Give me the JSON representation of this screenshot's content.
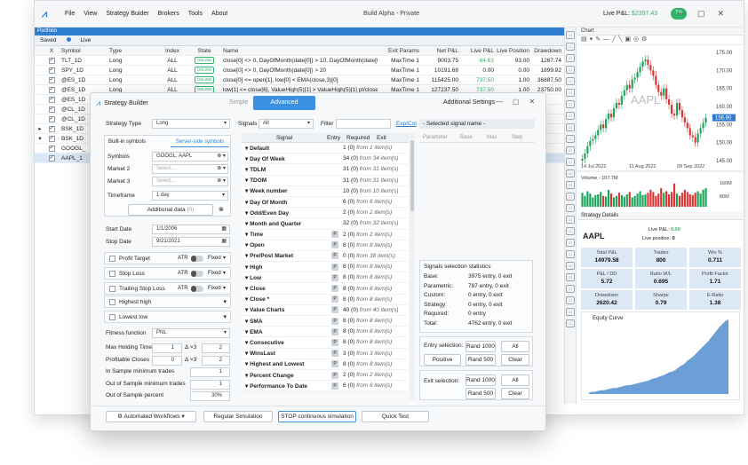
{
  "app": {
    "title": "Build Alpha - Private",
    "menu": [
      "File",
      "View",
      "Strategy Buider",
      "Brokers",
      "Tools",
      "About"
    ],
    "live_pnl_label": "Live P&L:",
    "live_pnl_value": "$2397.43",
    "user": "TS"
  },
  "portfolio": {
    "title": "Portfolio",
    "tabs": [
      "Saved",
      "Live"
    ],
    "columns": [
      "X",
      "Symbol",
      "Type",
      "Index",
      "State",
      "Name",
      "Exit Params",
      "Net P&L",
      "Live P&L",
      "Live Position",
      "Drawdown"
    ],
    "rows": [
      {
        "arrow": "",
        "sym": "TLT_1D",
        "type": "Long",
        "idx": "ALL",
        "state": "ONLINE",
        "name": "close[0] <> 0, DayOfMonth(date[0]) > 10, DayOfMonth(date[0]...",
        "ep": "MaxTime 1",
        "np": "9003.75",
        "lp": "84.63",
        "pos": "93.00",
        "dd": "1267.74",
        "lpg": true
      },
      {
        "arrow": "",
        "sym": "SPY_1D",
        "type": "Long",
        "idx": "ALL",
        "state": "ONLINE",
        "name": "close[0] <> 0, DayOfMonth(date[0]) > 20",
        "ep": "MaxTime 1",
        "np": "10191.68",
        "lp": "0.00",
        "pos": "0.00",
        "dd": "1899.92",
        "lpg": false
      },
      {
        "arrow": "",
        "sym": "@ES_1D",
        "type": "Long",
        "idx": "ALL",
        "state": "ONLINE",
        "name": "close[0] <= open[1], low[0] < EMA(close,3)[0]",
        "ep": "MaxTime 1",
        "np": "115425.00",
        "lp": "737.50",
        "pos": "1.00",
        "dd": "36887.50",
        "lpg": true
      },
      {
        "arrow": "",
        "sym": "@ES_1D",
        "type": "Long",
        "idx": "ALL",
        "state": "ONLINE",
        "name": "low[1] <= close[6], ValueHigh(5)[1] > ValueHigh(5)[1] pl/close",
        "ep": "MaxTime 1",
        "np": "127237.50",
        "lp": "737.50",
        "pos": "1.00",
        "dd": "23750.00",
        "lpg": true
      },
      {
        "arrow": "",
        "sym": "@ES_1D",
        "type": "",
        "idx": "",
        "state": "",
        "name": "",
        "ep": "",
        "np": "",
        "lp": "",
        "pos": "",
        "dd": "",
        "lpg": false
      },
      {
        "arrow": "",
        "sym": "@CL_1D",
        "type": "",
        "idx": "",
        "state": "",
        "name": "",
        "ep": "",
        "np": "",
        "lp": "",
        "pos": "",
        "dd": "",
        "lpg": false
      },
      {
        "arrow": "",
        "sym": "@CL_1D",
        "type": "",
        "idx": "",
        "state": "",
        "name": "",
        "ep": "",
        "np": "",
        "lp": "",
        "pos": "",
        "dd": "",
        "lpg": false
      },
      {
        "arrow": "▸",
        "sym": "BSK_1D",
        "type": "",
        "idx": "",
        "state": "",
        "name": "",
        "ep": "",
        "np": "",
        "lp": "",
        "pos": "",
        "dd": "",
        "lpg": false
      },
      {
        "arrow": "▾",
        "sym": "BSK_1D",
        "type": "",
        "idx": "",
        "state": "",
        "name": "",
        "ep": "",
        "np": "",
        "lp": "",
        "pos": "",
        "dd": "",
        "lpg": false
      },
      {
        "arrow": "",
        "sym": "GOOGL_",
        "type": "",
        "idx": "",
        "state": "",
        "name": "",
        "ep": "",
        "np": "",
        "lp": "",
        "pos": "",
        "dd": "",
        "lpg": false
      },
      {
        "arrow": "",
        "sym": "AAPL_1",
        "type": "",
        "idx": "",
        "state": "",
        "name": "",
        "ep": "",
        "np": "",
        "lp": "",
        "pos": "",
        "dd": "",
        "lpg": false
      }
    ]
  },
  "chart": {
    "title": "Chart",
    "symbol": "AAPL",
    "price_badge": "156.90",
    "yticks": [
      "175.00",
      "170.00",
      "165.00",
      "160.00",
      "155.00",
      "150.00",
      "145.00"
    ],
    "xticks": [
      "14 Jul 2022",
      "11 Aug 2022",
      "09 Sep 2022"
    ],
    "volume_label": "Volume - 107.7M",
    "vol_ticks": [
      "160M",
      "80M"
    ]
  },
  "chart_data": {
    "type": "candlestick",
    "x": [
      "14 Jul 2022",
      "11 Aug 2022",
      "09 Sep 2022"
    ],
    "ylim": [
      145,
      175
    ],
    "close": [
      145.5,
      147,
      149,
      150.5,
      151,
      152,
      153.5,
      155,
      154,
      156.5,
      158,
      157,
      159.5,
      161,
      160.5,
      163,
      164.5,
      166,
      165,
      167.5,
      168,
      169.5,
      171,
      172.5,
      173,
      171.5,
      170,
      168.5,
      166,
      164,
      163,
      165,
      162,
      160.5,
      158,
      157.5,
      161,
      159,
      157,
      155.5,
      154,
      152,
      151.5,
      150,
      152.5,
      154,
      155.5,
      156.9
    ],
    "volume": [
      90,
      70,
      100,
      85,
      60,
      75,
      80,
      95,
      70,
      65,
      110,
      85,
      60,
      70,
      90,
      75,
      65,
      80,
      95,
      60,
      70,
      85,
      100,
      75,
      80,
      90,
      110,
      95,
      70,
      85,
      120,
      90,
      100,
      80,
      95,
      150,
      85,
      70,
      90,
      110,
      95,
      80,
      75,
      90,
      100,
      85,
      110,
      120
    ]
  },
  "details": {
    "title": "Strategy Details",
    "symbol": "AAPL",
    "live_pnl_label": "Live P&L:",
    "live_pnl": "0.00",
    "live_pos_label": "Live position:",
    "live_pos": "0",
    "metrics": [
      {
        "k": "Total P&L",
        "v": "14979.58"
      },
      {
        "k": "Trades",
        "v": "800"
      },
      {
        "k": "Win %",
        "v": "0.711"
      },
      {
        "k": "P&L / DD",
        "v": "5.72"
      },
      {
        "k": "Ratio W/L",
        "v": "0.695"
      },
      {
        "k": "Profit Factor",
        "v": "1.71"
      },
      {
        "k": "Drawdown",
        "v": "2620.42"
      },
      {
        "k": "Sharpe",
        "v": "0.79"
      },
      {
        "k": "E-Ratio",
        "v": "1.38"
      }
    ],
    "equity_title": "Equity Curve",
    "equity": [
      2,
      3,
      3,
      4,
      5,
      5,
      6,
      7,
      8,
      8,
      9,
      10,
      11,
      12,
      12,
      13,
      14,
      15,
      16,
      17,
      18,
      20,
      21,
      22,
      24,
      25,
      27,
      29,
      30,
      32,
      35,
      38,
      40,
      44,
      47,
      50,
      54,
      58,
      62,
      66,
      70,
      75,
      80,
      85,
      90,
      94,
      98,
      100
    ]
  },
  "builder": {
    "title": "Strategy Builder",
    "tabs": [
      "Simple",
      "Advanced",
      "Additional Settings"
    ],
    "strategy_type_label": "Strategy Type",
    "strategy_type": "Long",
    "sym_tabs": [
      "Built-in symbols",
      "Server-side symbols"
    ],
    "symbols_label": "Symbols",
    "symbols": "GOOGL, AAPL",
    "market2_label": "Market 2",
    "market3_label": "Market 3",
    "select_ph": "Select...",
    "timeframe_label": "Timeframe",
    "timeframe": "1 day",
    "additional_data": "Additional data",
    "additional_count": "(0)",
    "start_label": "Start Date",
    "start": "1/1/2006",
    "stop_label": "Stop Date",
    "stop": "9/21/2021",
    "exits": [
      {
        "l": "Profit Target",
        "atr": "ATR",
        "mode": "Fixed"
      },
      {
        "l": "Stop Loss",
        "atr": "ATR",
        "mode": "Fixed"
      },
      {
        "l": "Trailing Stop Loss",
        "atr": "ATR",
        "mode": "Fixed"
      }
    ],
    "highest": "Highest high",
    "lowest": "Lowest low",
    "fitness_label": "Fitness function",
    "fitness": "PNL",
    "params": [
      {
        "l": "Max Holding Time",
        "v": "1",
        "d": "Δ ×3",
        "v2": "2"
      },
      {
        "l": "Profitable Closes",
        "v": "0",
        "d": "Δ ×3",
        "v2": "2"
      },
      {
        "l": "In Sample minimum trades",
        "v": "1"
      },
      {
        "l": "Out of Sample minimum trades",
        "v": "1"
      },
      {
        "l": "Out of Sample percent",
        "v": "30%"
      }
    ],
    "signals_label": "Signals",
    "signals_filter": "All",
    "filter_label": "Filter",
    "expcol": "Exp/Col",
    "selected_signal": "- Selected signal name -",
    "sig_cols": [
      "Signal",
      "Entry",
      "Required",
      "Exit"
    ],
    "param_cols": [
      "Parameter",
      "Base",
      "Max",
      "Step"
    ],
    "signals": [
      {
        "n": "Default",
        "p": false,
        "c": "1 (0)",
        "t": "from 1 item(s)"
      },
      {
        "n": "Day Of Week",
        "p": false,
        "c": "34 (0)",
        "t": "from 34 item(s)"
      },
      {
        "n": "TDLM",
        "p": false,
        "c": "31 (0)",
        "t": "from 31 item(s)"
      },
      {
        "n": "TDOM",
        "p": false,
        "c": "31 (0)",
        "t": "from 31 item(s)"
      },
      {
        "n": "Week number",
        "p": false,
        "c": "10 (0)",
        "t": "from 10 item(s)"
      },
      {
        "n": "Day Of Month",
        "p": false,
        "c": "6 (0)",
        "t": "from 6 item(s)"
      },
      {
        "n": "Odd/Even Day",
        "p": false,
        "c": "2 (0)",
        "t": "from 2 item(s)"
      },
      {
        "n": "Month and Quarter",
        "p": false,
        "c": "32 (0)",
        "t": "from 32 item(s)"
      },
      {
        "n": "Time",
        "p": true,
        "c": "2 (0)",
        "t": "from 2 item(s)"
      },
      {
        "n": "Open",
        "p": true,
        "c": "8 (0)",
        "t": "from 8 item(s)"
      },
      {
        "n": "Pre/Post Market",
        "p": true,
        "c": "0 (0)",
        "t": "from 38 item(s)"
      },
      {
        "n": "High",
        "p": true,
        "c": "8 (0)",
        "t": "from 8 item(s)"
      },
      {
        "n": "Low",
        "p": true,
        "c": "8 (0)",
        "t": "from 8 item(s)"
      },
      {
        "n": "Close",
        "p": true,
        "c": "8 (0)",
        "t": "from 8 item(s)"
      },
      {
        "n": "Close *",
        "p": true,
        "c": "8 (0)",
        "t": "from 8 item(s)"
      },
      {
        "n": "Value Charts",
        "p": true,
        "c": "40 (0)",
        "t": "from 40 item(s)"
      },
      {
        "n": "SMA",
        "p": true,
        "c": "8 (0)",
        "t": "from 8 item(s)"
      },
      {
        "n": "EMA",
        "p": true,
        "c": "8 (0)",
        "t": "from 8 item(s)"
      },
      {
        "n": "Consecutive",
        "p": true,
        "c": "8 (0)",
        "t": "from 8 item(s)"
      },
      {
        "n": "WinsLast",
        "p": true,
        "c": "3 (0)",
        "t": "from 3 item(s)"
      },
      {
        "n": "Highest and Lowest",
        "p": true,
        "c": "8 (0)",
        "t": "from 8 item(s)"
      },
      {
        "n": "Percent Change",
        "p": true,
        "c": "2 (0)",
        "t": "from 2 item(s)"
      },
      {
        "n": "Performance To Date",
        "p": true,
        "c": "6 (0)",
        "t": "from 6 item(s)"
      }
    ],
    "stats_title": "Signals selection statistics",
    "stats": [
      {
        "k": "Base:",
        "v": "3975 entry, 0 exit"
      },
      {
        "k": "Parametric:",
        "v": "787 entry, 0 exit"
      },
      {
        "k": "Custom:",
        "v": "0 entry, 0 exit"
      },
      {
        "k": "Strategy:",
        "v": "0 entry, 0 exit"
      },
      {
        "k": "Required:",
        "v": "0 entry"
      },
      {
        "k": "Total:",
        "v": "4762 entry, 0 exit"
      }
    ],
    "entry_sel": "Entry selection:",
    "exit_sel": "Exit selection:",
    "rand1000": "Rand 1000",
    "rand500": "Rand 500",
    "all": "All",
    "positive": "Positive",
    "clear": "Clear",
    "footer": [
      "Automated Workflows",
      "Regular Simulation",
      "STOP continuous simulation",
      "Quick Test"
    ]
  }
}
